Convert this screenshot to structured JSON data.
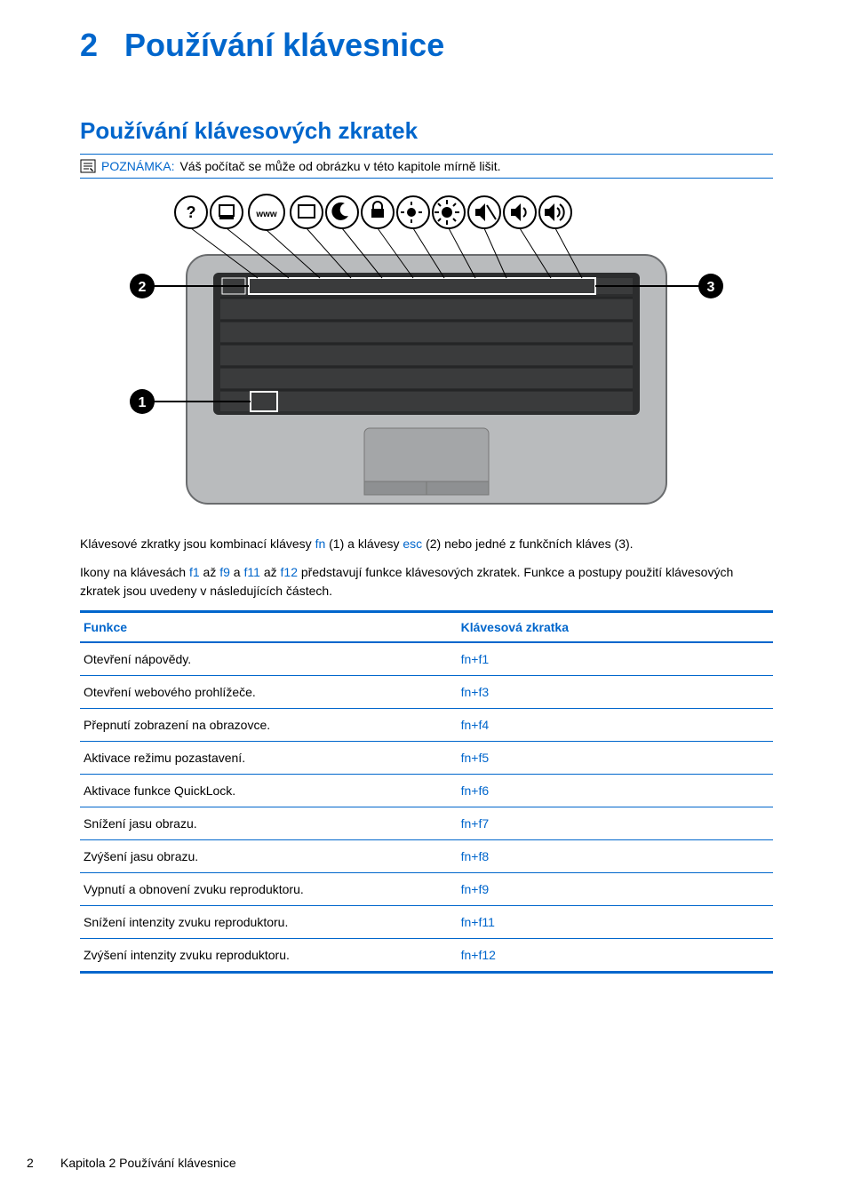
{
  "chapter": {
    "number": "2",
    "title": "Používání klávesnice"
  },
  "section": {
    "title": "Používání klávesových zkratek"
  },
  "note": {
    "label": "POZNÁMKA:",
    "text": "Váš počítač se může od obrázku v této kapitole mírně lišit."
  },
  "paragraphs": {
    "p1_a": "Klávesové zkratky jsou kombinací klávesy ",
    "p1_fn": "fn",
    "p1_b": " (1) a klávesy ",
    "p1_esc": "esc",
    "p1_c": " (2) nebo jedné z funkčních kláves (3).",
    "p2_a": "Ikony na klávesách ",
    "p2_f1": "f1",
    "p2_b": " až ",
    "p2_f9": "f9",
    "p2_c": " a ",
    "p2_f11": "f11",
    "p2_d": " až ",
    "p2_f12": "f12",
    "p2_e": " představují funkce klávesových zkratek. Funkce a postupy použití klávesových zkratek jsou uvedeny v následujících částech."
  },
  "table": {
    "header_func": "Funkce",
    "header_short": "Klávesová zkratka",
    "rows": [
      {
        "func": "Otevření nápovědy.",
        "short": "fn+f1"
      },
      {
        "func": "Otevření webového prohlížeče.",
        "short": "fn+f3"
      },
      {
        "func": "Přepnutí zobrazení na obrazovce.",
        "short": "fn+f4"
      },
      {
        "func": "Aktivace režimu pozastavení.",
        "short": "fn+f5"
      },
      {
        "func": "Aktivace funkce QuickLock.",
        "short": "fn+f6"
      },
      {
        "func": "Snížení jasu obrazu.",
        "short": "fn+f7"
      },
      {
        "func": "Zvýšení jasu obrazu.",
        "short": "fn+f8"
      },
      {
        "func": "Vypnutí a obnovení zvuku reproduktoru.",
        "short": "fn+f9"
      },
      {
        "func": "Snížení intenzity zvuku reproduktoru.",
        "short": "fn+f11"
      },
      {
        "func": "Zvýšení intenzity zvuku reproduktoru.",
        "short": "fn+f12"
      }
    ]
  },
  "image_callouts": {
    "label1": "1",
    "label2": "2",
    "label3": "3",
    "icons": [
      "help",
      "print",
      "www",
      "display",
      "sleep",
      "lock",
      "brightness-down",
      "brightness-up",
      "mute",
      "volume-down",
      "volume-up"
    ]
  },
  "footer": {
    "page": "2",
    "text": "Kapitola 2   Používání klávesnice"
  }
}
